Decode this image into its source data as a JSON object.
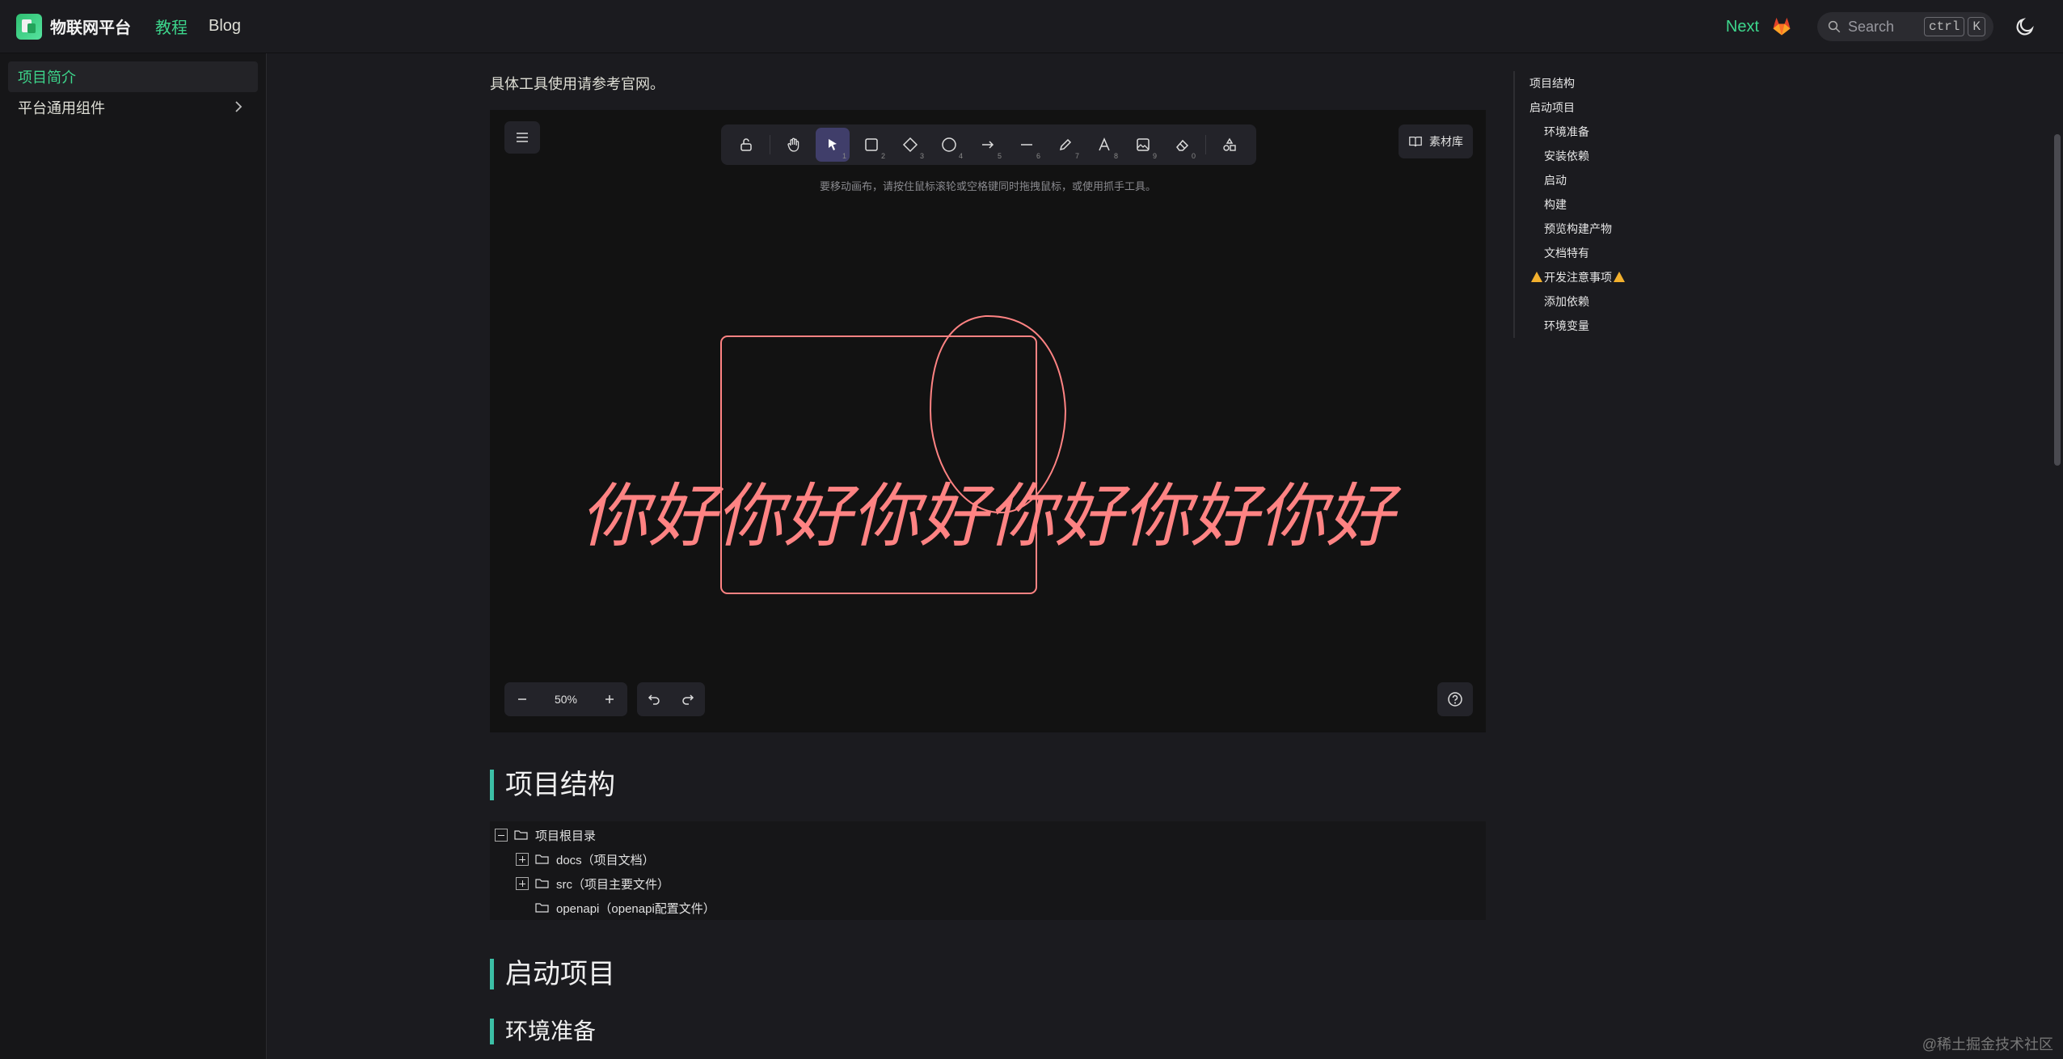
{
  "header": {
    "brand": "物联网平台",
    "nav": [
      {
        "label": "教程",
        "active": true
      },
      {
        "label": "Blog",
        "active": false
      }
    ],
    "next": "Next",
    "search": {
      "label": "Search",
      "keys": [
        "ctrl",
        "K"
      ]
    }
  },
  "sidebar": {
    "items": [
      {
        "label": "项目简介",
        "active": true
      },
      {
        "label": "平台通用组件",
        "active": false
      }
    ]
  },
  "main": {
    "intro": "具体工具使用请参考官网。",
    "board": {
      "library_label": "素材库",
      "hint": "要移动画布，请按住鼠标滚轮或空格键同时拖拽鼠标，或使用抓手工具。",
      "zoom": "50%",
      "tool_shortcuts": [
        "1",
        "2",
        "3",
        "4",
        "5",
        "6",
        "7",
        "8",
        "9",
        "0"
      ],
      "drawing_text": "你好你好你好你好你好你好"
    },
    "sections": {
      "structure": "项目结构",
      "start": "启动项目",
      "env": "环境准备"
    },
    "tree": [
      {
        "label": "项目根目录"
      },
      {
        "label": "docs（项目文档）"
      },
      {
        "label": "src（项目主要文件）"
      },
      {
        "label": "openapi（openapi配置文件）"
      }
    ]
  },
  "toc": [
    {
      "label": "项目结构",
      "level": 1
    },
    {
      "label": "启动项目",
      "level": 1
    },
    {
      "label": "环境准备",
      "level": 2
    },
    {
      "label": "安装依赖",
      "level": 2
    },
    {
      "label": "启动",
      "level": 2
    },
    {
      "label": "构建",
      "level": 2
    },
    {
      "label": "预览构建产物",
      "level": 2
    },
    {
      "label": "文档特有",
      "level": 2
    },
    {
      "label": "开发注意事项",
      "level": 1,
      "warning": true
    },
    {
      "label": "添加依赖",
      "level": 2
    },
    {
      "label": "环境变量",
      "level": 2
    }
  ],
  "watermark": "@稀土掘金技术社区",
  "colors": {
    "accent": "#3dd68c",
    "pen": "#ff8383",
    "heading_bar": "#3cbfa6"
  }
}
